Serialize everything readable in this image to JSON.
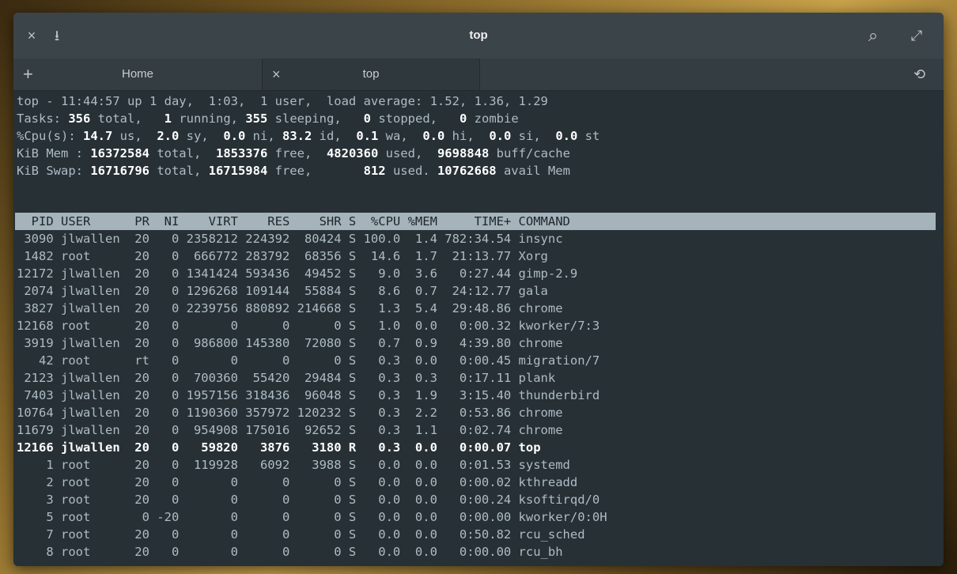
{
  "window": {
    "title": "top",
    "close_glyph": "×",
    "pin_glyph": "⭳",
    "search_glyph": "⌕",
    "maximize_glyph": "⤢"
  },
  "tabs": {
    "new_tab_glyph": "+",
    "home_label": "Home",
    "top_close_glyph": "×",
    "top_label": "top",
    "history_glyph": "⟲"
  },
  "summary": {
    "line1": "top - 11:44:57 up 1 day,  1:03,  1 user,  load average: 1.52, 1.36, 1.29",
    "tasks_label": "Tasks: ",
    "tasks_total": "356",
    "tasks_total_lbl": " total,   ",
    "tasks_running": "1",
    "tasks_running_lbl": " running, ",
    "tasks_sleeping": "355",
    "tasks_sleeping_lbl": " sleeping,   ",
    "tasks_stopped": "0",
    "tasks_stopped_lbl": " stopped,   ",
    "tasks_zombie": "0",
    "tasks_zombie_lbl": " zombie",
    "cpu_label": "%Cpu(s): ",
    "cpu_us": "14.7",
    "cpu_us_lbl": " us,  ",
    "cpu_sy": "2.0",
    "cpu_sy_lbl": " sy,  ",
    "cpu_ni": "0.0",
    "cpu_ni_lbl": " ni, ",
    "cpu_id": "83.2",
    "cpu_id_lbl": " id,  ",
    "cpu_wa": "0.1",
    "cpu_wa_lbl": " wa,  ",
    "cpu_hi": "0.0",
    "cpu_hi_lbl": " hi,  ",
    "cpu_si": "0.0",
    "cpu_si_lbl": " si,  ",
    "cpu_st": "0.0",
    "cpu_st_lbl": " st",
    "mem_label": "KiB Mem : ",
    "mem_total": "16372584",
    "mem_total_lbl": " total,  ",
    "mem_free": "1853376",
    "mem_free_lbl": " free,  ",
    "mem_used": "4820360",
    "mem_used_lbl": " used,  ",
    "mem_buff": "9698848",
    "mem_buff_lbl": " buff/cache",
    "swap_label": "KiB Swap: ",
    "swap_total": "16716796",
    "swap_total_lbl": " total, ",
    "swap_free": "16715984",
    "swap_free_lbl": " free,       ",
    "swap_used": "812",
    "swap_used_lbl": " used. ",
    "swap_avail": "10762668",
    "swap_avail_lbl": " avail Mem"
  },
  "table": {
    "header": "  PID USER      PR  NI    VIRT    RES    SHR S  %CPU %MEM     TIME+ COMMAND",
    "rows": [
      " 3090 jlwallen  20   0 2358212 224392  80424 S 100.0  1.4 782:34.54 insync",
      " 1482 root      20   0  666772 283792  68356 S  14.6  1.7  21:13.77 Xorg",
      "12172 jlwallen  20   0 1341424 593436  49452 S   9.0  3.6   0:27.44 gimp-2.9",
      " 2074 jlwallen  20   0 1296268 109144  55884 S   8.6  0.7  24:12.77 gala",
      " 3827 jlwallen  20   0 2239756 880892 214668 S   1.3  5.4  29:48.86 chrome",
      "12168 root      20   0       0      0      0 S   1.0  0.0   0:00.32 kworker/7:3",
      " 3919 jlwallen  20   0  986800 145380  72080 S   0.7  0.9   4:39.80 chrome",
      "   42 root      rt   0       0      0      0 S   0.3  0.0   0:00.45 migration/7",
      " 2123 jlwallen  20   0  700360  55420  29484 S   0.3  0.3   0:17.11 plank",
      " 7403 jlwallen  20   0 1957156 318436  96048 S   0.3  1.9   3:15.40 thunderbird",
      "10764 jlwallen  20   0 1190360 357972 120232 S   0.3  2.2   0:53.86 chrome",
      "11679 jlwallen  20   0  954908 175016  92652 S   0.3  1.1   0:02.74 chrome",
      "12166 jlwallen  20   0   59820   3876   3180 R   0.3  0.0   0:00.07 top",
      "    1 root      20   0  119928   6092   3988 S   0.0  0.0   0:01.53 systemd",
      "    2 root      20   0       0      0      0 S   0.0  0.0   0:00.02 kthreadd",
      "    3 root      20   0       0      0      0 S   0.0  0.0   0:00.24 ksoftirqd/0",
      "    5 root       0 -20       0      0      0 S   0.0  0.0   0:00.00 kworker/0:0H",
      "    7 root      20   0       0      0      0 S   0.0  0.0   0:50.82 rcu_sched",
      "    8 root      20   0       0      0      0 S   0.0  0.0   0:00.00 rcu_bh"
    ],
    "bold_row_index": 12
  }
}
